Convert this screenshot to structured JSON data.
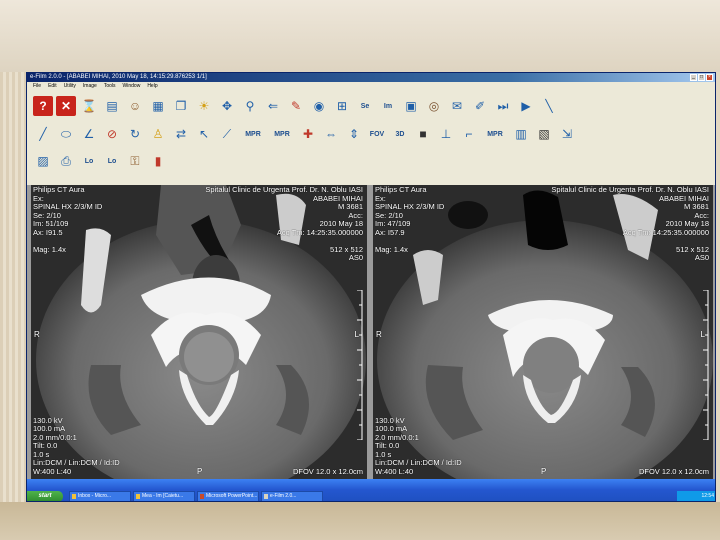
{
  "window": {
    "title": "e-Film 2.0.0 - [ABABEI MIHAI, 2010 May 18, 14:15:29.876253 1/1]",
    "menu": [
      "File",
      "Edit",
      "Utility",
      "Image",
      "Tools",
      "Window",
      "Help"
    ]
  },
  "toolbar": {
    "row1": [
      "help-icon",
      "close-icon",
      "hourglass-icon",
      "stack-icon",
      "user-icon",
      "book-icon",
      "layers-icon",
      "sun-icon",
      "move-icon",
      "zoom-icon",
      "arrow-left-icon",
      "edit-icon",
      "palette-icon",
      "grid-icon",
      "Se",
      "Im",
      "grid2-icon",
      "eye-icon",
      "note-icon",
      "pencil-icon",
      "next-icon",
      "play-icon",
      "ruler-icon"
    ],
    "row2": [
      "line-icon",
      "ellipse-icon",
      "angle-icon",
      "erase-icon",
      "rotate-icon",
      "person-icon",
      "flip-icon",
      "cursor-icon",
      "measure-icon",
      "MPR",
      "MPR",
      "plus-icon",
      "swap-icon",
      "updown-icon",
      "FOV",
      "3D",
      "square-icon",
      "axis-icon",
      "text-icon",
      "MPR",
      "bars-icon",
      "film-icon",
      "export-icon"
    ],
    "row3": [
      "save-icon",
      "print-icon",
      "lo-icon",
      "lo2-icon",
      "lock-icon",
      "key-icon"
    ]
  },
  "viewers": [
    {
      "top_left": "Philips CT Aura\nEx:\nSPINAL HX 2/3/M ID\nSe: 2/10\nIm: 51/109\nAx: I91.5\n\nMag: 1.4x",
      "top_right": "Spitalul Clinic de Urgenta Prof. Dr. N. Oblu IASI\nABABEI MIHAI\nM 3681\nAcc:\n2010 May 18\nAcq Tm: 14:25:35.000000\n\n512 x 512\nAS0",
      "left_orientation": "R",
      "right_orientation": "L",
      "bottom_left": "130.0 kV\n100.0 mA\n2.0 mm/0.0:1\nTilt: 0.0\n1.0 s\nLin:DCM / Lin:DCM / Id:ID\nW:400 L:40",
      "bottom_center": "P",
      "bottom_right": "DFOV 12.0 x 12.0cm"
    },
    {
      "top_left": "Philips CT Aura\nEx:\nSPINAL HX 2/3/M ID\nSe: 2/10\nIm: 47/109\nAx: I57.9\n\nMag: 1.4x",
      "top_right": "Spitalul Clinic de Urgenta Prof. Dr. N. Oblu IASI\nABABEI MIHAI\nM 3681\nAcc:\n2010 May 18\nAcq Tm: 14:25:35.000000\n\n512 x 512\nAS0",
      "left_orientation": "R",
      "right_orientation": "L",
      "bottom_left": "130.0 kV\n100.0 mA\n2.0 mm/0.0:1\nTilt: 0.0\n1.0 s\nLin:DCM / Lin:DCM / Id:ID\nW:400 L:40",
      "bottom_center": "P",
      "bottom_right": "DFOV 12.0 x 12.0cm"
    }
  ],
  "taskbar": {
    "start": "start",
    "tasks": [
      "Inbox - Micro...",
      "Mea - Im [Caietu...",
      "Microsoft PowerPoint...",
      "e-Film 2.0..."
    ],
    "clock": "12:54"
  }
}
